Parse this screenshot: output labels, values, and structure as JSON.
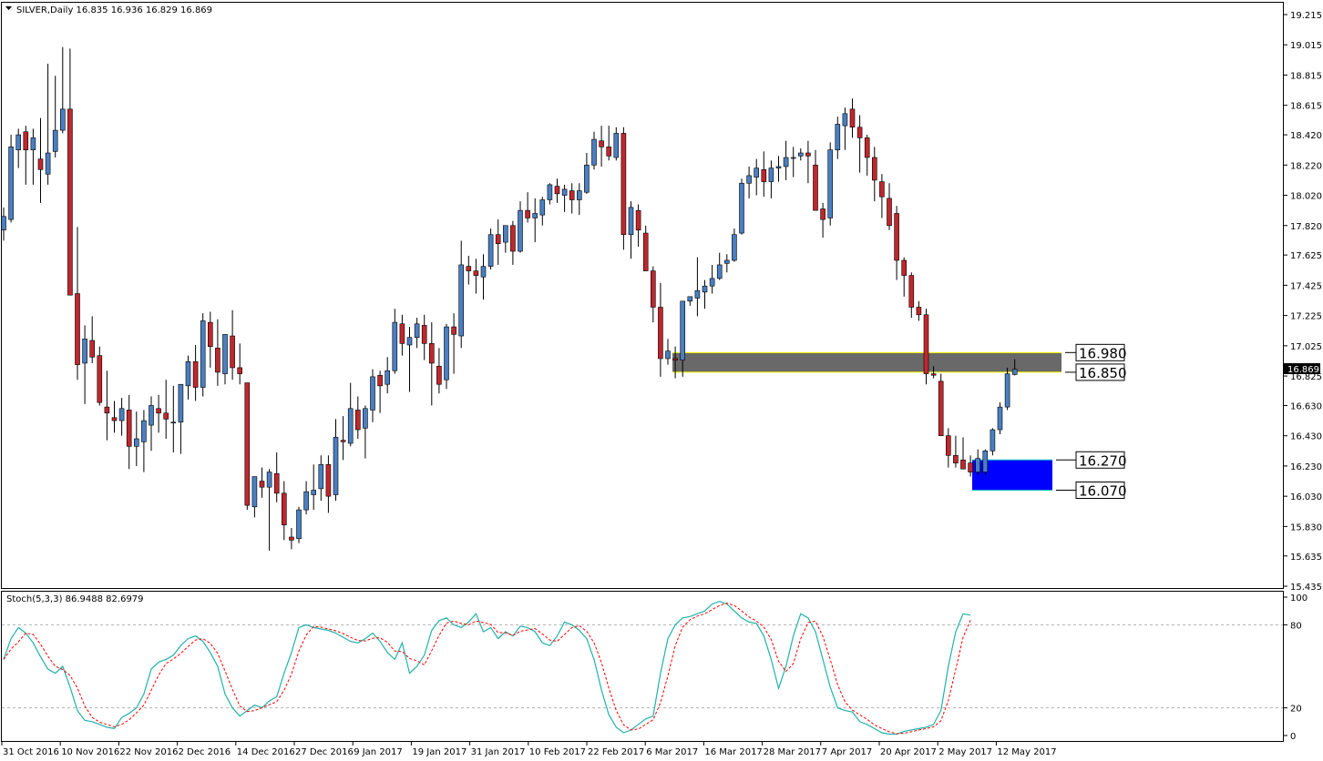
{
  "main_header": {
    "text": "SILVER,Daily  16.835 16.936 16.829 16.869"
  },
  "stoch_header": {
    "text": "Stoch(5,3,3) 86.9488 82.6979"
  },
  "price_axis": {
    "labels": [
      "19.215",
      "19.015",
      "18.815",
      "18.615",
      "18.420",
      "18.220",
      "18.020",
      "17.820",
      "17.625",
      "17.425",
      "17.225",
      "17.025",
      "16.825",
      "16.630",
      "16.430",
      "16.230",
      "16.030",
      "15.830",
      "15.635",
      "15.435"
    ],
    "current_price": "16.869"
  },
  "stoch_axis": {
    "labels": [
      "100",
      "80",
      "20",
      "0"
    ]
  },
  "time_axis": {
    "labels": [
      "31 Oct 2016",
      "10 Nov 2016",
      "22 Nov 2016",
      "2 Dec 2016",
      "14 Dec 2016",
      "27 Dec 2016",
      "9 Jan 2017",
      "19 Jan 2017",
      "31 Jan 2017",
      "10 Feb 2017",
      "22 Feb 2017",
      "6 Mar 2017",
      "16 Mar 2017",
      "28 Mar 2017",
      "7 Apr 2017",
      "20 Apr 2017",
      "2 May 2017",
      "12 May 2017"
    ]
  },
  "zones": [
    {
      "name": "resistance-zone",
      "top_label": "16.980",
      "bottom_label": "16.850",
      "top": 16.98,
      "bottom": 16.85,
      "fill": "#696969",
      "edge": "#ffff00"
    },
    {
      "name": "support-zone",
      "top_label": "16.270",
      "bottom_label": "16.070",
      "top": 16.27,
      "bottom": 16.07,
      "fill": "#0000ff",
      "edge": "#00c0c0"
    }
  ],
  "colors": {
    "bull": "#4a7fc1",
    "bear": "#c0272d",
    "wick": "#000000",
    "stoch_main": "#20b2aa",
    "stoch_signal": "#ff0000",
    "level_line": "#b0b0b0"
  },
  "chart_data": {
    "type": "candlestick",
    "title": "SILVER,Daily",
    "ohlc_header": {
      "open": 16.835,
      "high": 16.936,
      "low": 16.829,
      "close": 16.869
    },
    "ylim": [
      15.435,
      19.215
    ],
    "candles": [
      [
        17.79,
        17.94,
        17.72,
        17.88
      ],
      [
        17.86,
        18.42,
        17.84,
        18.34
      ],
      [
        18.32,
        18.46,
        18.2,
        18.42
      ],
      [
        18.44,
        18.48,
        18.09,
        18.32
      ],
      [
        18.32,
        18.46,
        18.09,
        18.4
      ],
      [
        18.26,
        18.53,
        17.97,
        18.19
      ],
      [
        18.16,
        18.89,
        18.09,
        18.3
      ],
      [
        18.31,
        18.81,
        18.27,
        18.45
      ],
      [
        18.45,
        19.0,
        18.43,
        18.59
      ],
      [
        18.59,
        18.99,
        18.48,
        17.36
      ],
      [
        17.37,
        17.81,
        16.8,
        16.9
      ],
      [
        16.91,
        17.16,
        16.64,
        17.07
      ],
      [
        17.06,
        17.22,
        16.91,
        16.95
      ],
      [
        16.96,
        17.02,
        16.63,
        16.65
      ],
      [
        16.62,
        16.86,
        16.4,
        16.58
      ],
      [
        16.55,
        16.66,
        16.45,
        16.53
      ],
      [
        16.53,
        16.68,
        16.43,
        16.61
      ],
      [
        16.6,
        16.7,
        16.21,
        16.36
      ],
      [
        16.36,
        16.59,
        16.23,
        16.41
      ],
      [
        16.39,
        16.6,
        16.19,
        16.53
      ],
      [
        16.5,
        16.69,
        16.33,
        16.63
      ],
      [
        16.61,
        16.7,
        16.45,
        16.58
      ],
      [
        16.58,
        16.8,
        16.41,
        16.54
      ],
      [
        16.52,
        16.76,
        16.32,
        16.52
      ],
      [
        16.52,
        16.7,
        16.31,
        16.77
      ],
      [
        16.76,
        16.96,
        16.67,
        16.92
      ],
      [
        16.92,
        17.03,
        16.66,
        16.75
      ],
      [
        16.75,
        17.24,
        16.69,
        17.19
      ],
      [
        17.18,
        17.25,
        16.88,
        17.02
      ],
      [
        17.01,
        17.2,
        16.76,
        16.85
      ],
      [
        16.84,
        17.04,
        16.77,
        17.1
      ],
      [
        17.09,
        17.26,
        16.8,
        16.88
      ],
      [
        16.88,
        17.04,
        16.77,
        16.84
      ],
      [
        16.78,
        16.78,
        15.94,
        15.97
      ],
      [
        15.96,
        16.08,
        15.89,
        16.16
      ],
      [
        16.13,
        16.22,
        16.02,
        16.09
      ],
      [
        16.09,
        16.21,
        15.67,
        16.19
      ],
      [
        16.18,
        16.32,
        15.99,
        16.05
      ],
      [
        16.05,
        16.13,
        15.74,
        15.84
      ],
      [
        15.76,
        15.82,
        15.68,
        15.74
      ],
      [
        15.75,
        15.96,
        15.72,
        15.94
      ],
      [
        15.94,
        16.13,
        15.91,
        16.06
      ],
      [
        16.04,
        16.24,
        15.94,
        16.07
      ],
      [
        16.08,
        16.3,
        16.0,
        16.24
      ],
      [
        16.24,
        16.3,
        15.92,
        16.03
      ],
      [
        16.04,
        16.54,
        16.0,
        16.42
      ],
      [
        16.4,
        16.56,
        16.27,
        16.39
      ],
      [
        16.38,
        16.78,
        16.36,
        16.61
      ],
      [
        16.6,
        16.69,
        16.41,
        16.47
      ],
      [
        16.48,
        16.63,
        16.28,
        16.61
      ],
      [
        16.6,
        16.87,
        16.52,
        16.82
      ],
      [
        16.83,
        16.86,
        16.58,
        16.76
      ],
      [
        16.77,
        16.95,
        16.71,
        16.86
      ],
      [
        16.86,
        17.27,
        16.84,
        17.18
      ],
      [
        17.17,
        17.23,
        16.96,
        17.04
      ],
      [
        17.03,
        17.15,
        16.72,
        17.08
      ],
      [
        17.08,
        17.21,
        17.01,
        17.17
      ],
      [
        17.16,
        17.23,
        16.93,
        17.04
      ],
      [
        17.04,
        17.18,
        16.63,
        16.91
      ],
      [
        16.89,
        17.01,
        16.71,
        16.77
      ],
      [
        16.8,
        17.17,
        16.74,
        17.15
      ],
      [
        17.15,
        17.24,
        16.84,
        17.1
      ],
      [
        17.09,
        17.72,
        17.01,
        17.56
      ],
      [
        17.55,
        17.62,
        17.43,
        17.52
      ],
      [
        17.52,
        17.6,
        17.37,
        17.49
      ],
      [
        17.48,
        17.63,
        17.33,
        17.55
      ],
      [
        17.55,
        17.8,
        17.53,
        17.76
      ],
      [
        17.76,
        17.86,
        17.56,
        17.7
      ],
      [
        17.71,
        17.82,
        17.64,
        17.82
      ],
      [
        17.82,
        17.85,
        17.56,
        17.65
      ],
      [
        17.65,
        17.98,
        17.64,
        17.92
      ],
      [
        17.92,
        18.04,
        17.84,
        17.87
      ],
      [
        17.87,
        18.0,
        17.71,
        17.9
      ],
      [
        17.89,
        18.01,
        17.82,
        17.99
      ],
      [
        17.99,
        18.1,
        17.96,
        18.09
      ],
      [
        18.08,
        18.13,
        17.97,
        18.03
      ],
      [
        18.02,
        18.09,
        17.91,
        18.06
      ],
      [
        18.05,
        18.1,
        17.9,
        17.99
      ],
      [
        17.99,
        18.1,
        17.89,
        18.05
      ],
      [
        18.04,
        18.3,
        18.03,
        18.22
      ],
      [
        18.22,
        18.44,
        18.19,
        18.39
      ],
      [
        18.38,
        18.48,
        18.21,
        18.34
      ],
      [
        18.34,
        18.48,
        18.25,
        18.28
      ],
      [
        18.27,
        18.47,
        18.25,
        18.43
      ],
      [
        18.43,
        18.47,
        17.66,
        17.76
      ],
      [
        17.76,
        17.98,
        17.6,
        17.94
      ],
      [
        17.92,
        17.96,
        17.68,
        17.79
      ],
      [
        17.77,
        17.82,
        17.53,
        17.52
      ],
      [
        17.52,
        17.55,
        17.18,
        17.28
      ],
      [
        17.28,
        17.44,
        16.82,
        16.94
      ],
      [
        16.94,
        17.07,
        16.9,
        16.99
      ],
      [
        16.94,
        17.02,
        16.81,
        16.93
      ],
      [
        16.93,
        17.15,
        16.82,
        17.32
      ],
      [
        17.32,
        17.34,
        17.29,
        17.35
      ],
      [
        17.34,
        17.61,
        17.22,
        17.39
      ],
      [
        17.38,
        17.46,
        17.27,
        17.42
      ],
      [
        17.42,
        17.56,
        17.37,
        17.47
      ],
      [
        17.47,
        17.64,
        17.46,
        17.56
      ],
      [
        17.57,
        17.63,
        17.51,
        17.59
      ],
      [
        17.59,
        17.8,
        17.58,
        17.76
      ],
      [
        17.77,
        18.13,
        17.76,
        18.1
      ],
      [
        18.1,
        18.21,
        18.0,
        18.15
      ],
      [
        18.14,
        18.26,
        18.02,
        18.2
      ],
      [
        18.19,
        18.31,
        18.01,
        18.11
      ],
      [
        18.11,
        18.25,
        18.0,
        18.2
      ],
      [
        18.2,
        18.28,
        18.11,
        18.21
      ],
      [
        18.21,
        18.38,
        18.12,
        18.27
      ],
      [
        18.27,
        18.34,
        18.14,
        18.27
      ],
      [
        18.28,
        18.33,
        18.25,
        18.3
      ],
      [
        18.3,
        18.38,
        18.1,
        18.28
      ],
      [
        18.22,
        18.32,
        17.99,
        17.92
      ],
      [
        17.93,
        17.97,
        17.74,
        17.86
      ],
      [
        17.87,
        18.37,
        17.82,
        18.32
      ],
      [
        18.32,
        18.54,
        18.26,
        18.49
      ],
      [
        18.48,
        18.6,
        18.32,
        18.56
      ],
      [
        18.59,
        18.66,
        18.4,
        18.47
      ],
      [
        18.47,
        18.55,
        18.17,
        18.4
      ],
      [
        18.4,
        18.42,
        18.15,
        18.27
      ],
      [
        18.27,
        18.34,
        17.98,
        18.12
      ],
      [
        18.11,
        18.16,
        17.87,
        18.01
      ],
      [
        18.0,
        18.1,
        17.79,
        17.82
      ],
      [
        17.9,
        17.95,
        17.46,
        17.59
      ],
      [
        17.59,
        17.61,
        17.35,
        17.49
      ],
      [
        17.49,
        17.51,
        17.21,
        17.28
      ],
      [
        17.28,
        17.32,
        17.19,
        17.23
      ],
      [
        17.23,
        17.27,
        16.77,
        16.84
      ],
      [
        16.84,
        16.89,
        16.81,
        16.83
      ],
      [
        16.79,
        16.84,
        16.47,
        16.43
      ],
      [
        16.43,
        16.48,
        16.22,
        16.3
      ],
      [
        16.3,
        16.43,
        16.22,
        16.25
      ],
      [
        16.27,
        16.42,
        16.24,
        16.21
      ],
      [
        16.25,
        16.3,
        16.16,
        16.19
      ],
      [
        16.19,
        16.34,
        16.17,
        16.28
      ],
      [
        16.19,
        16.34,
        16.17,
        16.33
      ],
      [
        16.33,
        16.48,
        16.3,
        16.47
      ],
      [
        16.47,
        16.65,
        16.44,
        16.62
      ],
      [
        16.62,
        16.88,
        16.6,
        16.84
      ],
      [
        16.835,
        16.936,
        16.829,
        16.869
      ]
    ],
    "stoch_main": [
      55,
      70,
      78,
      74,
      67,
      57,
      48,
      45,
      50,
      35,
      18,
      11,
      10,
      8,
      6,
      5,
      13,
      16,
      20,
      30,
      48,
      53,
      55,
      58,
      65,
      70,
      72,
      68,
      60,
      50,
      30,
      20,
      14,
      18,
      22,
      20,
      25,
      28,
      45,
      60,
      78,
      80,
      78,
      77,
      76,
      74,
      71,
      68,
      67,
      70,
      74,
      68,
      60,
      55,
      67,
      45,
      50,
      58,
      76,
      83,
      85,
      80,
      78,
      82,
      88,
      75,
      78,
      70,
      75,
      72,
      79,
      78,
      75,
      67,
      65,
      72,
      82,
      80,
      76,
      70,
      55,
      33,
      15,
      6,
      2,
      4,
      8,
      12,
      14,
      45,
      70,
      80,
      85,
      86,
      88,
      90,
      95,
      97,
      95,
      90,
      85,
      82,
      81,
      72,
      55,
      34,
      50,
      72,
      88,
      85,
      75,
      55,
      35,
      20,
      18,
      17,
      10,
      8,
      5,
      2,
      1,
      1,
      3,
      4,
      5,
      6,
      8,
      18,
      50,
      75,
      88,
      87
    ]
  }
}
